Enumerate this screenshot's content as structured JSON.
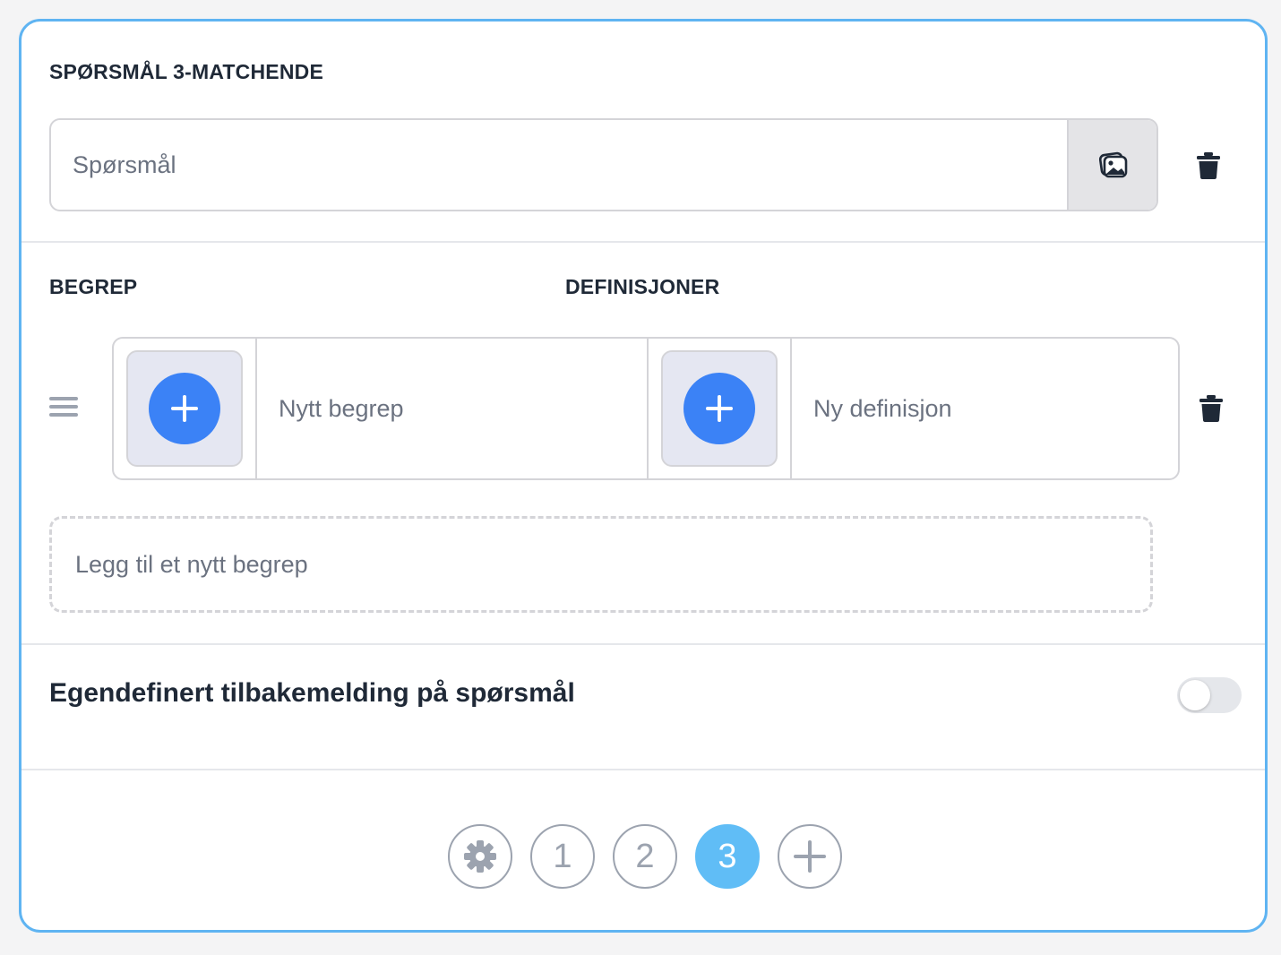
{
  "question": {
    "section_title": "SPØRSMÅL 3-MATCHENDE",
    "input_placeholder": "Spørsmål",
    "input_value": ""
  },
  "matching": {
    "term_header": "BEGREP",
    "definition_header": "DEFINISJONER",
    "rows": [
      {
        "term_placeholder": "Nytt begrep",
        "definition_placeholder": "Ny definisjon"
      }
    ],
    "add_term_label": "Legg til et nytt begrep"
  },
  "feedback": {
    "label": "Egendefinert tilbakemelding på spørsmål",
    "enabled": false
  },
  "pagination": {
    "pages": [
      "1",
      "2",
      "3"
    ],
    "active_page": "3"
  },
  "icons": {
    "image": "image-icon",
    "trash": "trash-icon",
    "drag": "drag-handle-icon",
    "plus": "plus-icon",
    "settings": "gear-icon"
  },
  "colors": {
    "card_border": "#5fb4f2",
    "accent_blue": "#3b82f6",
    "active_page": "#60bdf6"
  }
}
